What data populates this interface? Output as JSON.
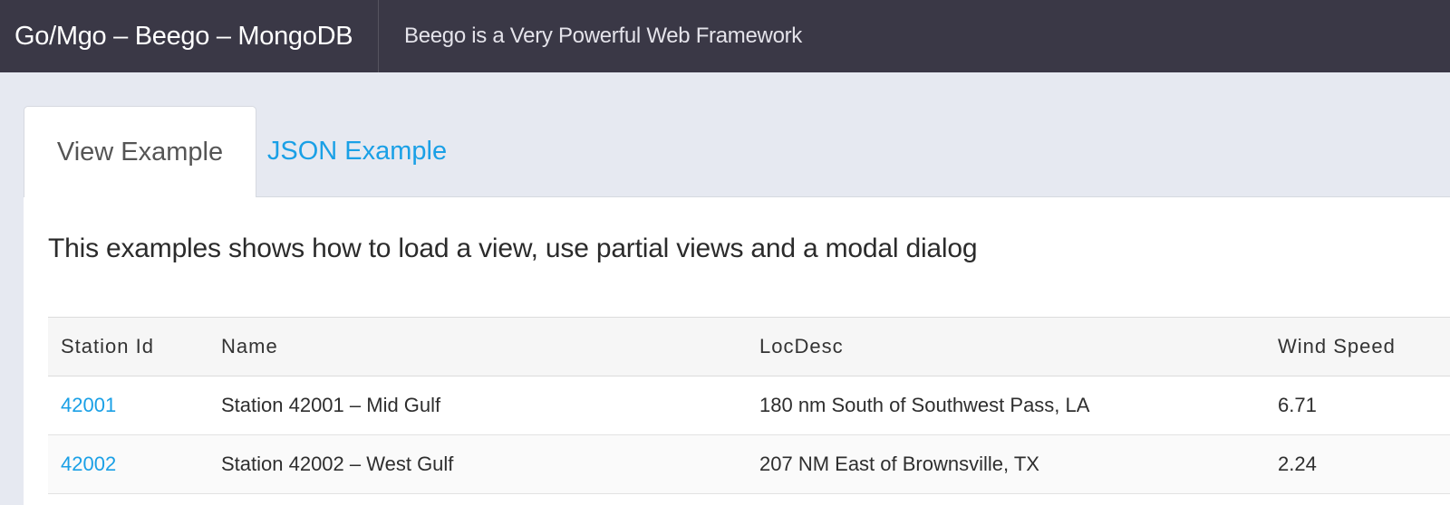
{
  "header": {
    "brand": "Go/Mgo – Beego – MongoDB",
    "tagline": "Beego is a Very Powerful Web Framework"
  },
  "tabs": [
    {
      "label": "View Example",
      "active": true
    },
    {
      "label": "JSON Example",
      "active": false
    }
  ],
  "main": {
    "heading": "This examples shows how to load a view, use partial views and a modal dialog"
  },
  "table": {
    "columns": [
      "Station Id",
      "Name",
      "LocDesc",
      "Wind Speed"
    ],
    "rows": [
      {
        "station_id": "42001",
        "name": "Station 42001 – Mid Gulf",
        "loc_desc": "180 nm South of Southwest Pass, LA",
        "wind_speed": "6.71"
      },
      {
        "station_id": "42002",
        "name": "Station 42002 – West Gulf",
        "loc_desc": "207 NM East of Brownsville, TX",
        "wind_speed": "2.24"
      }
    ]
  },
  "colors": {
    "header_bg": "#3a3846",
    "page_bg": "#e6e9f1",
    "link": "#1aa0e6"
  }
}
